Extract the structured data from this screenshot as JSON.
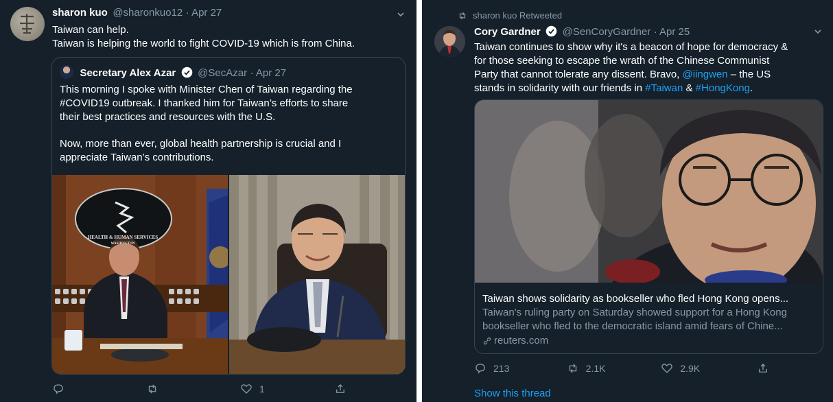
{
  "left_tweet": {
    "author_name": "sharon kuo",
    "handle": "@sharonkuo12",
    "date": "Apr 27",
    "text_line1": "Taiwan can help.",
    "text_line2": "Taiwan is helping the world to fight COVID-19 which is from China.",
    "quoted": {
      "author_name": "Secretary Alex Azar",
      "handle": "@SecAzar",
      "date": "Apr 27",
      "para1_line1": "This morning I spoke with Minister Chen of Taiwan regarding the",
      "para1_line2": "#COVID19 outbreak. I thanked him for Taiwan’s efforts to share",
      "para1_line3": "their best practices and resources with the U.S.",
      "para2_line1": "Now, more than ever, global health partnership is crucial and I",
      "para2_line2": "appreciate Taiwan’s contributions.",
      "seal_line1": "HEALTH & HUMAN SERVICES",
      "seal_line2": "WASHINGTON"
    },
    "actions": {
      "reply": "",
      "retweet": "",
      "like": "1"
    }
  },
  "right_tweet": {
    "retweet_label": "sharon kuo Retweeted",
    "author_name": "Cory Gardner",
    "handle": "@SenCoryGardner",
    "date": "Apr 25",
    "line1": "Taiwan continues to show why it's a beacon of hope for democracy &",
    "line2": "for those seeking to escape the wrath of the Chinese Communist",
    "line3_pre": "Party that cannot tolerate any dissent. Bravo, ",
    "line3_mention": "@iingwen",
    "line3_post": " – the US",
    "line4_pre": "stands in solidarity with our friends in ",
    "line4_tag1": "#Taiwan",
    "line4_mid": " & ",
    "line4_tag2": "#HongKong",
    "line4_post": ".",
    "card": {
      "title": "Taiwan shows solidarity as bookseller who fled Hong Kong opens...",
      "desc_line1": "Taiwan's ruling party on Saturday showed support for a Hong Kong",
      "desc_line2": "bookseller who fled to the democratic island amid fears of Chine...",
      "domain": "reuters.com"
    },
    "actions": {
      "reply": "213",
      "retweet": "2.1K",
      "like": "2.9K"
    },
    "show_thread": "Show this thread"
  },
  "colors": {
    "background": "#15202b",
    "muted": "#8899a6",
    "link": "#1da1f2",
    "border": "#38444d"
  }
}
